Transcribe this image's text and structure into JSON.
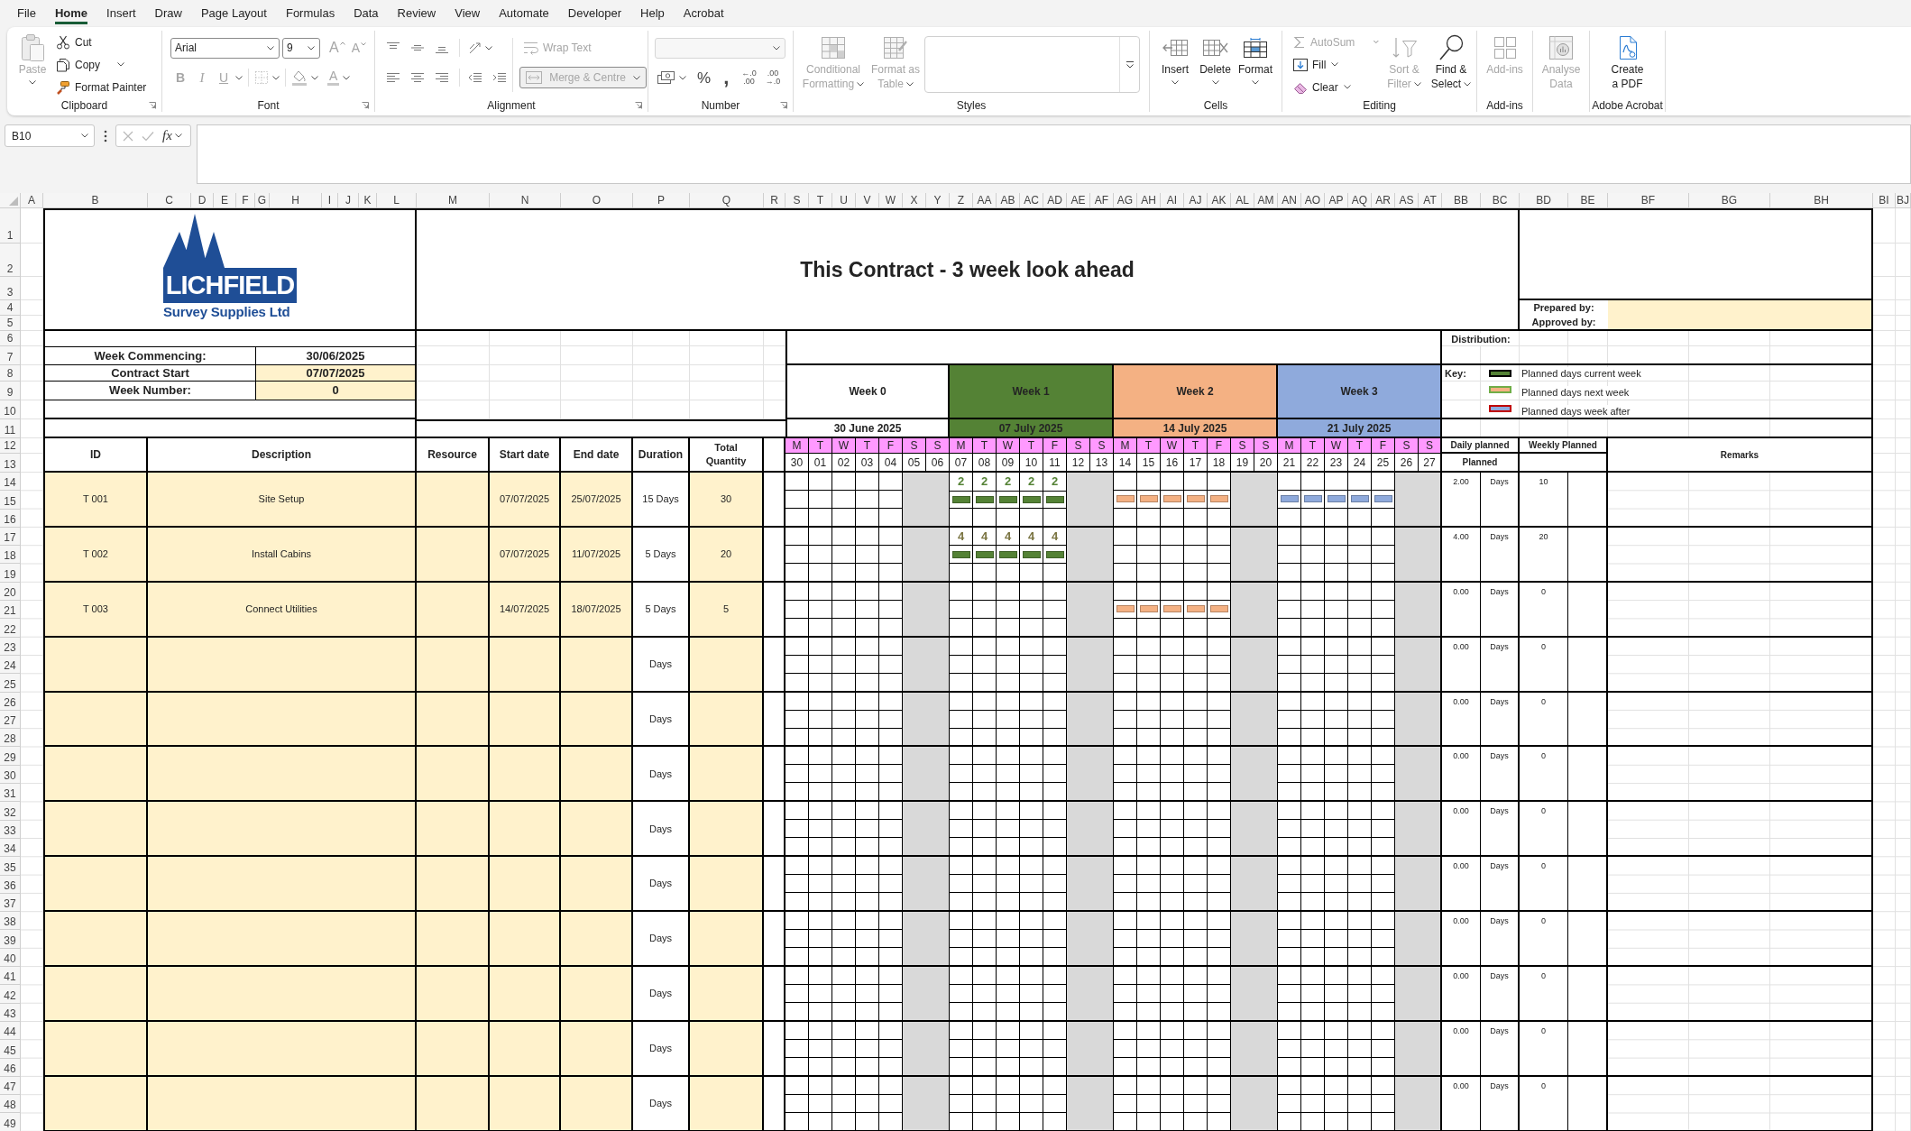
{
  "menu_tabs": [
    {
      "label": "File",
      "selected": false
    },
    {
      "label": "Home",
      "selected": true
    },
    {
      "label": "Insert",
      "selected": false
    },
    {
      "label": "Draw",
      "selected": false
    },
    {
      "label": "Page Layout",
      "selected": false
    },
    {
      "label": "Formulas",
      "selected": false
    },
    {
      "label": "Data",
      "selected": false
    },
    {
      "label": "Review",
      "selected": false
    },
    {
      "label": "View",
      "selected": false
    },
    {
      "label": "Automate",
      "selected": false
    },
    {
      "label": "Developer",
      "selected": false
    },
    {
      "label": "Help",
      "selected": false
    },
    {
      "label": "Acrobat",
      "selected": false
    }
  ],
  "ribbon": {
    "clipboard": {
      "label": "Clipboard",
      "paste": {
        "label": "Paste",
        "disabled": true
      },
      "cut": {
        "label": "Cut",
        "disabled": false
      },
      "copy": {
        "label": "Copy",
        "disabled": false
      },
      "format_painter": {
        "label": "Format Painter",
        "disabled": false
      }
    },
    "font": {
      "label": "Font",
      "font_name": "Arial",
      "font_size": "9",
      "grow": {
        "label": "A",
        "disabled": true
      },
      "shrink": {
        "label": "A",
        "disabled": true
      },
      "bold": {
        "label": "B",
        "disabled": true
      },
      "italic": {
        "label": "I",
        "disabled": true
      },
      "underline": {
        "label": "U",
        "disabled": true
      },
      "font_color": {
        "label": "A",
        "disabled": true
      }
    },
    "alignment": {
      "label": "Alignment",
      "wrap_text": {
        "label": "Wrap Text",
        "disabled": true
      },
      "merge": {
        "label": "Merge & Centre",
        "disabled": true
      }
    },
    "number": {
      "label": "Number",
      "format": {
        "disabled": true
      },
      "percent": "%",
      "comma": ",",
      "increase_decimal": {
        "top": "←.0",
        "bottom": ".00"
      },
      "decrease_decimal": {
        "top": ".00",
        "bottom": "→.0"
      }
    },
    "styles": {
      "label": "Styles",
      "conditional_formatting": {
        "label": "Conditional Formatting",
        "disabled": true
      },
      "format_as_table": {
        "label": "Format as Table",
        "disabled": true
      }
    },
    "cells": {
      "label": "Cells",
      "insert": {
        "label": "Insert",
        "disabled": false
      },
      "delete": {
        "label": "Delete",
        "disabled": false
      },
      "format": {
        "label": "Format",
        "disabled": false
      }
    },
    "editing": {
      "label": "Editing",
      "autosum": {
        "label": "AutoSum",
        "disabled": true
      },
      "fill": {
        "label": "Fill",
        "disabled": false
      },
      "clear": {
        "label": "Clear",
        "disabled": false
      },
      "sort_filter": {
        "label": "Sort & Filter",
        "disabled": true
      },
      "find_select": {
        "label": "Find & Select",
        "disabled": false
      }
    },
    "addins": {
      "label": "Add-ins",
      "addins": {
        "label": "Add-ins",
        "disabled": true
      }
    },
    "analysis": {
      "analyse_data": {
        "label": "Analyse Data",
        "disabled": true
      }
    },
    "acrobat": {
      "label": "Adobe Acrobat",
      "create_pdf": {
        "label": "Create a PDF",
        "disabled": false
      }
    }
  },
  "formula_bar": {
    "name_box": "B10",
    "fx": "fx"
  },
  "columns": [
    "A",
    "B",
    "C",
    "D",
    "E",
    "F",
    "G",
    "H",
    "I",
    "J",
    "K",
    "L",
    "M",
    "N",
    "O",
    "P",
    "Q",
    "R",
    "S",
    "T",
    "U",
    "V",
    "W",
    "X",
    "Y",
    "Z",
    "AA",
    "AB",
    "AC",
    "AD",
    "AE",
    "AF",
    "AG",
    "AH",
    "AI",
    "AJ",
    "AK",
    "AL",
    "AM",
    "AN",
    "AO",
    "AP",
    "AQ",
    "AR",
    "AS",
    "AT",
    "BB",
    "BC",
    "BD",
    "BE",
    "BF",
    "BG",
    "BH",
    "BI",
    "BJ"
  ],
  "row_numbers": [
    "1",
    "2",
    "3",
    "4",
    "5",
    "6",
    "7",
    "8",
    "9",
    "10",
    "11",
    "12",
    "13",
    "14",
    "15",
    "16",
    "17",
    "18",
    "19",
    "20",
    "21",
    "22",
    "23",
    "24",
    "25",
    "26",
    "27",
    "28",
    "29",
    "30",
    "31",
    "32",
    "33",
    "34",
    "35",
    "36",
    "37",
    "38",
    "39",
    "40",
    "41",
    "42",
    "43",
    "44",
    "45",
    "46",
    "47",
    "48",
    "49"
  ],
  "sheet": {
    "logo": {
      "wordmark": "LICHFIELD",
      "tagline": "Survey Supplies Ltd"
    },
    "title": "This Contract - 3 week look ahead",
    "signoff": [
      {
        "label": "Prepared by:"
      },
      {
        "label": "Approved by:"
      }
    ],
    "info_rows": [
      {
        "label": "Week Commencing:",
        "value": "30/06/2025",
        "highlighted": false
      },
      {
        "label": "Contract Start",
        "value": "07/07/2025",
        "highlighted": true
      },
      {
        "label": "Week Number:",
        "value": "0",
        "highlighted": true
      }
    ],
    "distribution_label": "Distribution:",
    "key": {
      "label": "Key:",
      "items": [
        {
          "label": "Planned days current week",
          "color": "#548235",
          "border": {
            "color": "#000000"
          }
        },
        {
          "label": "Planned days next week",
          "color": "#f4b183",
          "border": {
            "color": "#70ad47"
          }
        },
        {
          "label": "Planned days week after",
          "color": "#8faadc",
          "border": {
            "color": "#c00000"
          }
        }
      ]
    },
    "weeks": [
      {
        "label": "Week 0",
        "date": "30 June 2025",
        "color": "#ffffff",
        "days": [
          {
            "letter": "M",
            "number": "30",
            "weekend": false
          },
          {
            "letter": "T",
            "number": "01",
            "weekend": false
          },
          {
            "letter": "W",
            "number": "02",
            "weekend": false
          },
          {
            "letter": "T",
            "number": "03",
            "weekend": false
          },
          {
            "letter": "F",
            "number": "04",
            "weekend": false
          },
          {
            "letter": "S",
            "number": "05",
            "weekend": true
          },
          {
            "letter": "S",
            "number": "06",
            "weekend": true
          }
        ]
      },
      {
        "label": "Week 1",
        "date": "07 July 2025",
        "color": "#548235",
        "days": [
          {
            "letter": "M",
            "number": "07",
            "weekend": false
          },
          {
            "letter": "T",
            "number": "08",
            "weekend": false
          },
          {
            "letter": "W",
            "number": "09",
            "weekend": false
          },
          {
            "letter": "T",
            "number": "10",
            "weekend": false
          },
          {
            "letter": "F",
            "number": "11",
            "weekend": false
          },
          {
            "letter": "S",
            "number": "12",
            "weekend": true
          },
          {
            "letter": "S",
            "number": "13",
            "weekend": true
          }
        ]
      },
      {
        "label": "Week 2",
        "date": "14 July 2025",
        "color": "#f4b183",
        "days": [
          {
            "letter": "M",
            "number": "14",
            "weekend": false
          },
          {
            "letter": "T",
            "number": "15",
            "weekend": false
          },
          {
            "letter": "W",
            "number": "16",
            "weekend": false
          },
          {
            "letter": "T",
            "number": "17",
            "weekend": false
          },
          {
            "letter": "F",
            "number": "18",
            "weekend": false
          },
          {
            "letter": "S",
            "number": "19",
            "weekend": true
          },
          {
            "letter": "S",
            "number": "20",
            "weekend": true
          }
        ]
      },
      {
        "label": "Week 3",
        "date": "21 July 2025",
        "color": "#8faadc",
        "days": [
          {
            "letter": "M",
            "number": "21",
            "weekend": false
          },
          {
            "letter": "T",
            "number": "22",
            "weekend": false
          },
          {
            "letter": "W",
            "number": "23",
            "weekend": false
          },
          {
            "letter": "T",
            "number": "24",
            "weekend": false
          },
          {
            "letter": "F",
            "number": "25",
            "weekend": false
          },
          {
            "letter": "S",
            "number": "26",
            "weekend": true
          },
          {
            "letter": "S",
            "number": "27",
            "weekend": true
          }
        ]
      }
    ],
    "table_headers": {
      "id": "ID",
      "description": "Description",
      "resource": "Resource",
      "start": "Start date",
      "end": "End date",
      "duration": "Duration",
      "quantity": "Total Quantity"
    },
    "summary_headers": {
      "daily": "Daily planned",
      "planned": "Planned",
      "weekly": "Weekly Planned",
      "remarks": "Remarks"
    },
    "tasks": [
      {
        "id": "T 001",
        "description": "Site Setup",
        "start": "07/07/2025",
        "end": "25/07/2025",
        "duration": "15 Days",
        "quantity": "30",
        "rate": "2.00",
        "unit": "Days",
        "weekly": "10",
        "weeks": [
          {
            "planned": false
          },
          {
            "planned": true,
            "values": [
              {
                "text": "2",
                "color": "#548235"
              },
              {
                "text": "2",
                "color": "#548235"
              },
              {
                "text": "2",
                "color": "#548235"
              },
              {
                "text": "2",
                "color": "#548235"
              },
              {
                "text": "2",
                "color": "#548235"
              }
            ]
          },
          {
            "planned": true
          },
          {
            "planned": true
          }
        ]
      },
      {
        "id": "T 002",
        "description": "Install Cabins",
        "start": "07/07/2025",
        "end": "11/07/2025",
        "duration": "5 Days",
        "quantity": "20",
        "rate": "4.00",
        "unit": "Days",
        "weekly": "20",
        "weeks": [
          {
            "planned": false
          },
          {
            "planned": true,
            "values": [
              {
                "text": "4",
                "color": "#7a7442"
              },
              {
                "text": "4",
                "color": "#7a7442"
              },
              {
                "text": "4",
                "color": "#7a7442"
              },
              {
                "text": "4",
                "color": "#7a7442"
              },
              {
                "text": "4",
                "color": "#7a7442"
              }
            ]
          },
          {
            "planned": false
          },
          {
            "planned": false
          }
        ]
      },
      {
        "id": "T 003",
        "description": "Connect Utilities",
        "start": "14/07/2025",
        "end": "18/07/2025",
        "duration": "5 Days",
        "quantity": "5",
        "rate": "0.00",
        "unit": "Days",
        "weekly": "0",
        "weeks": [
          {
            "planned": false
          },
          {
            "planned": false
          },
          {
            "planned": true
          },
          {
            "planned": false
          }
        ]
      },
      {
        "duration": "Days",
        "rate": "0.00",
        "unit": "Days",
        "weekly": "0",
        "weeks": [
          {
            "planned": false
          },
          {
            "planned": false
          },
          {
            "planned": false
          },
          {
            "planned": false
          }
        ]
      },
      {
        "duration": "Days",
        "rate": "0.00",
        "unit": "Days",
        "weekly": "0",
        "weeks": [
          {
            "planned": false
          },
          {
            "planned": false
          },
          {
            "planned": false
          },
          {
            "planned": false
          }
        ]
      },
      {
        "duration": "Days",
        "rate": "0.00",
        "unit": "Days",
        "weekly": "0",
        "weeks": [
          {
            "planned": false
          },
          {
            "planned": false
          },
          {
            "planned": false
          },
          {
            "planned": false
          }
        ]
      },
      {
        "duration": "Days",
        "rate": "0.00",
        "unit": "Days",
        "weekly": "0",
        "weeks": [
          {
            "planned": false
          },
          {
            "planned": false
          },
          {
            "planned": false
          },
          {
            "planned": false
          }
        ]
      },
      {
        "duration": "Days",
        "rate": "0.00",
        "unit": "Days",
        "weekly": "0",
        "weeks": [
          {
            "planned": false
          },
          {
            "planned": false
          },
          {
            "planned": false
          },
          {
            "planned": false
          }
        ]
      },
      {
        "duration": "Days",
        "rate": "0.00",
        "unit": "Days",
        "weekly": "0",
        "weeks": [
          {
            "planned": false
          },
          {
            "planned": false
          },
          {
            "planned": false
          },
          {
            "planned": false
          }
        ]
      },
      {
        "duration": "Days",
        "rate": "0.00",
        "unit": "Days",
        "weekly": "0",
        "weeks": [
          {
            "planned": false
          },
          {
            "planned": false
          },
          {
            "planned": false
          },
          {
            "planned": false
          }
        ]
      },
      {
        "duration": "Days",
        "rate": "0.00",
        "unit": "Days",
        "weekly": "0",
        "weeks": [
          {
            "planned": false
          },
          {
            "planned": false
          },
          {
            "planned": false
          },
          {
            "planned": false
          }
        ]
      },
      {
        "duration": "Days",
        "rate": "0.00",
        "unit": "Days",
        "weekly": "0",
        "weeks": [
          {
            "planned": false
          },
          {
            "planned": false
          },
          {
            "planned": false
          },
          {
            "planned": false
          }
        ]
      }
    ]
  }
}
